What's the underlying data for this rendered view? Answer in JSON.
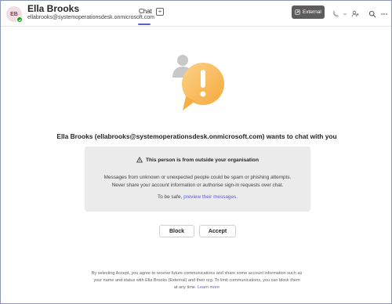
{
  "header": {
    "avatar_initials": "EB",
    "name": "Ella Brooks",
    "email": "ellabrooks@systemoperationsdesk.onmicrosoft.com",
    "tab_chat": "Chat",
    "tab_add": "+",
    "external_label": "External"
  },
  "main": {
    "heading": "Ella Brooks (ellabrooks@systemoperationsdesk.onmicrosoft.com) wants to chat with you",
    "warning_title": "This person is from outside your organisation",
    "warning_line1": "Messages from unknown or unexpected people could be spam or phishing attempts.",
    "warning_line2": "Never share your account information or authorise sign-in requests over chat.",
    "safe_prefix": "To be safe,",
    "safe_link": "preview their messages."
  },
  "buttons": {
    "block": "Block",
    "accept": "Accept"
  },
  "footer": {
    "line1": "By selecting Accept, you agree to receive future communications and share some account information such as",
    "line2": "your name and status with Ella Brooks (External) and their org. To limit communications, you can block them",
    "line3_prefix": "at any time.",
    "learn_more": "Learn more"
  },
  "colors": {
    "accent": "#5b5fc7",
    "external_badge": "#5c5c5c",
    "presence": "#13a10e",
    "warning_bubble": "#f7b24a"
  }
}
